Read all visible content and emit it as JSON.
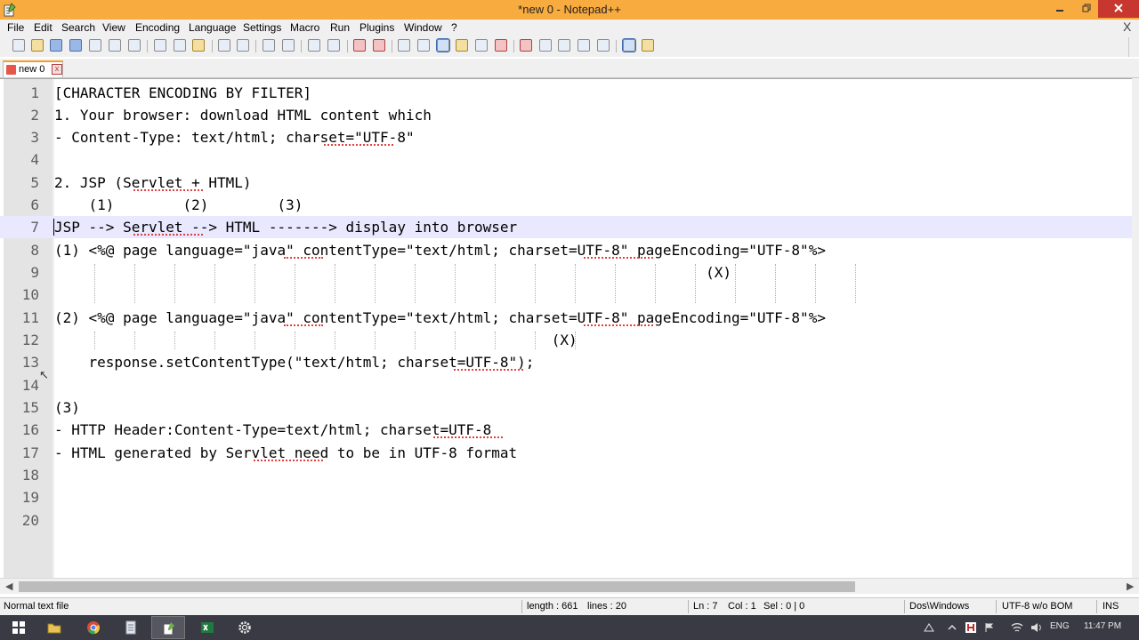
{
  "window": {
    "title": "*new  0 - Notepad++"
  },
  "menu": [
    "File",
    "Edit",
    "Search",
    "View",
    "Encoding",
    "Language",
    "Settings",
    "Macro",
    "Run",
    "Plugins",
    "Window",
    "?"
  ],
  "menu_close_glyph": "X",
  "tab": {
    "label": "new  0",
    "close_glyph": "x"
  },
  "editor": {
    "lines": [
      "[CHARACTER ENCODING BY FILTER]",
      "1. Your browser: download HTML content which",
      "- Content-Type: text/html; charset=\"UTF-8\"",
      "",
      "2. JSP (Servlet + HTML)",
      "    (1)        (2)        (3)",
      "JSP --> Servlet --> HTML -------> display into browser",
      "(1) <%@ page language=\"java\" contentType=\"text/html; charset=UTF-8\" pageEncoding=\"UTF-8\"%>",
      "                                                                            (X)",
      "",
      "(2) <%@ page language=\"java\" contentType=\"text/html; charset=UTF-8\" pageEncoding=\"UTF-8\"%>",
      "                                                          (X)",
      "    response.setContentType(\"text/html; charset=UTF-8\");",
      "",
      "(3)",
      "- HTTP Header:Content-Type=text/html; charset=UTF-8",
      "- HTML generated by Servlet need to be in UTF-8 format",
      "",
      "",
      ""
    ],
    "current_line": 7
  },
  "status": {
    "file_type": "Normal text file",
    "length": "length : 661",
    "lines": "lines : 20",
    "ln": "Ln : 7",
    "col": "Col : 1",
    "sel": "Sel : 0 | 0",
    "eol": "Dos\\Windows",
    "encoding": "UTF-8 w/o BOM",
    "mode": "INS"
  },
  "taskbar": {
    "lang": "ENG",
    "clock": "11:47 PM"
  }
}
